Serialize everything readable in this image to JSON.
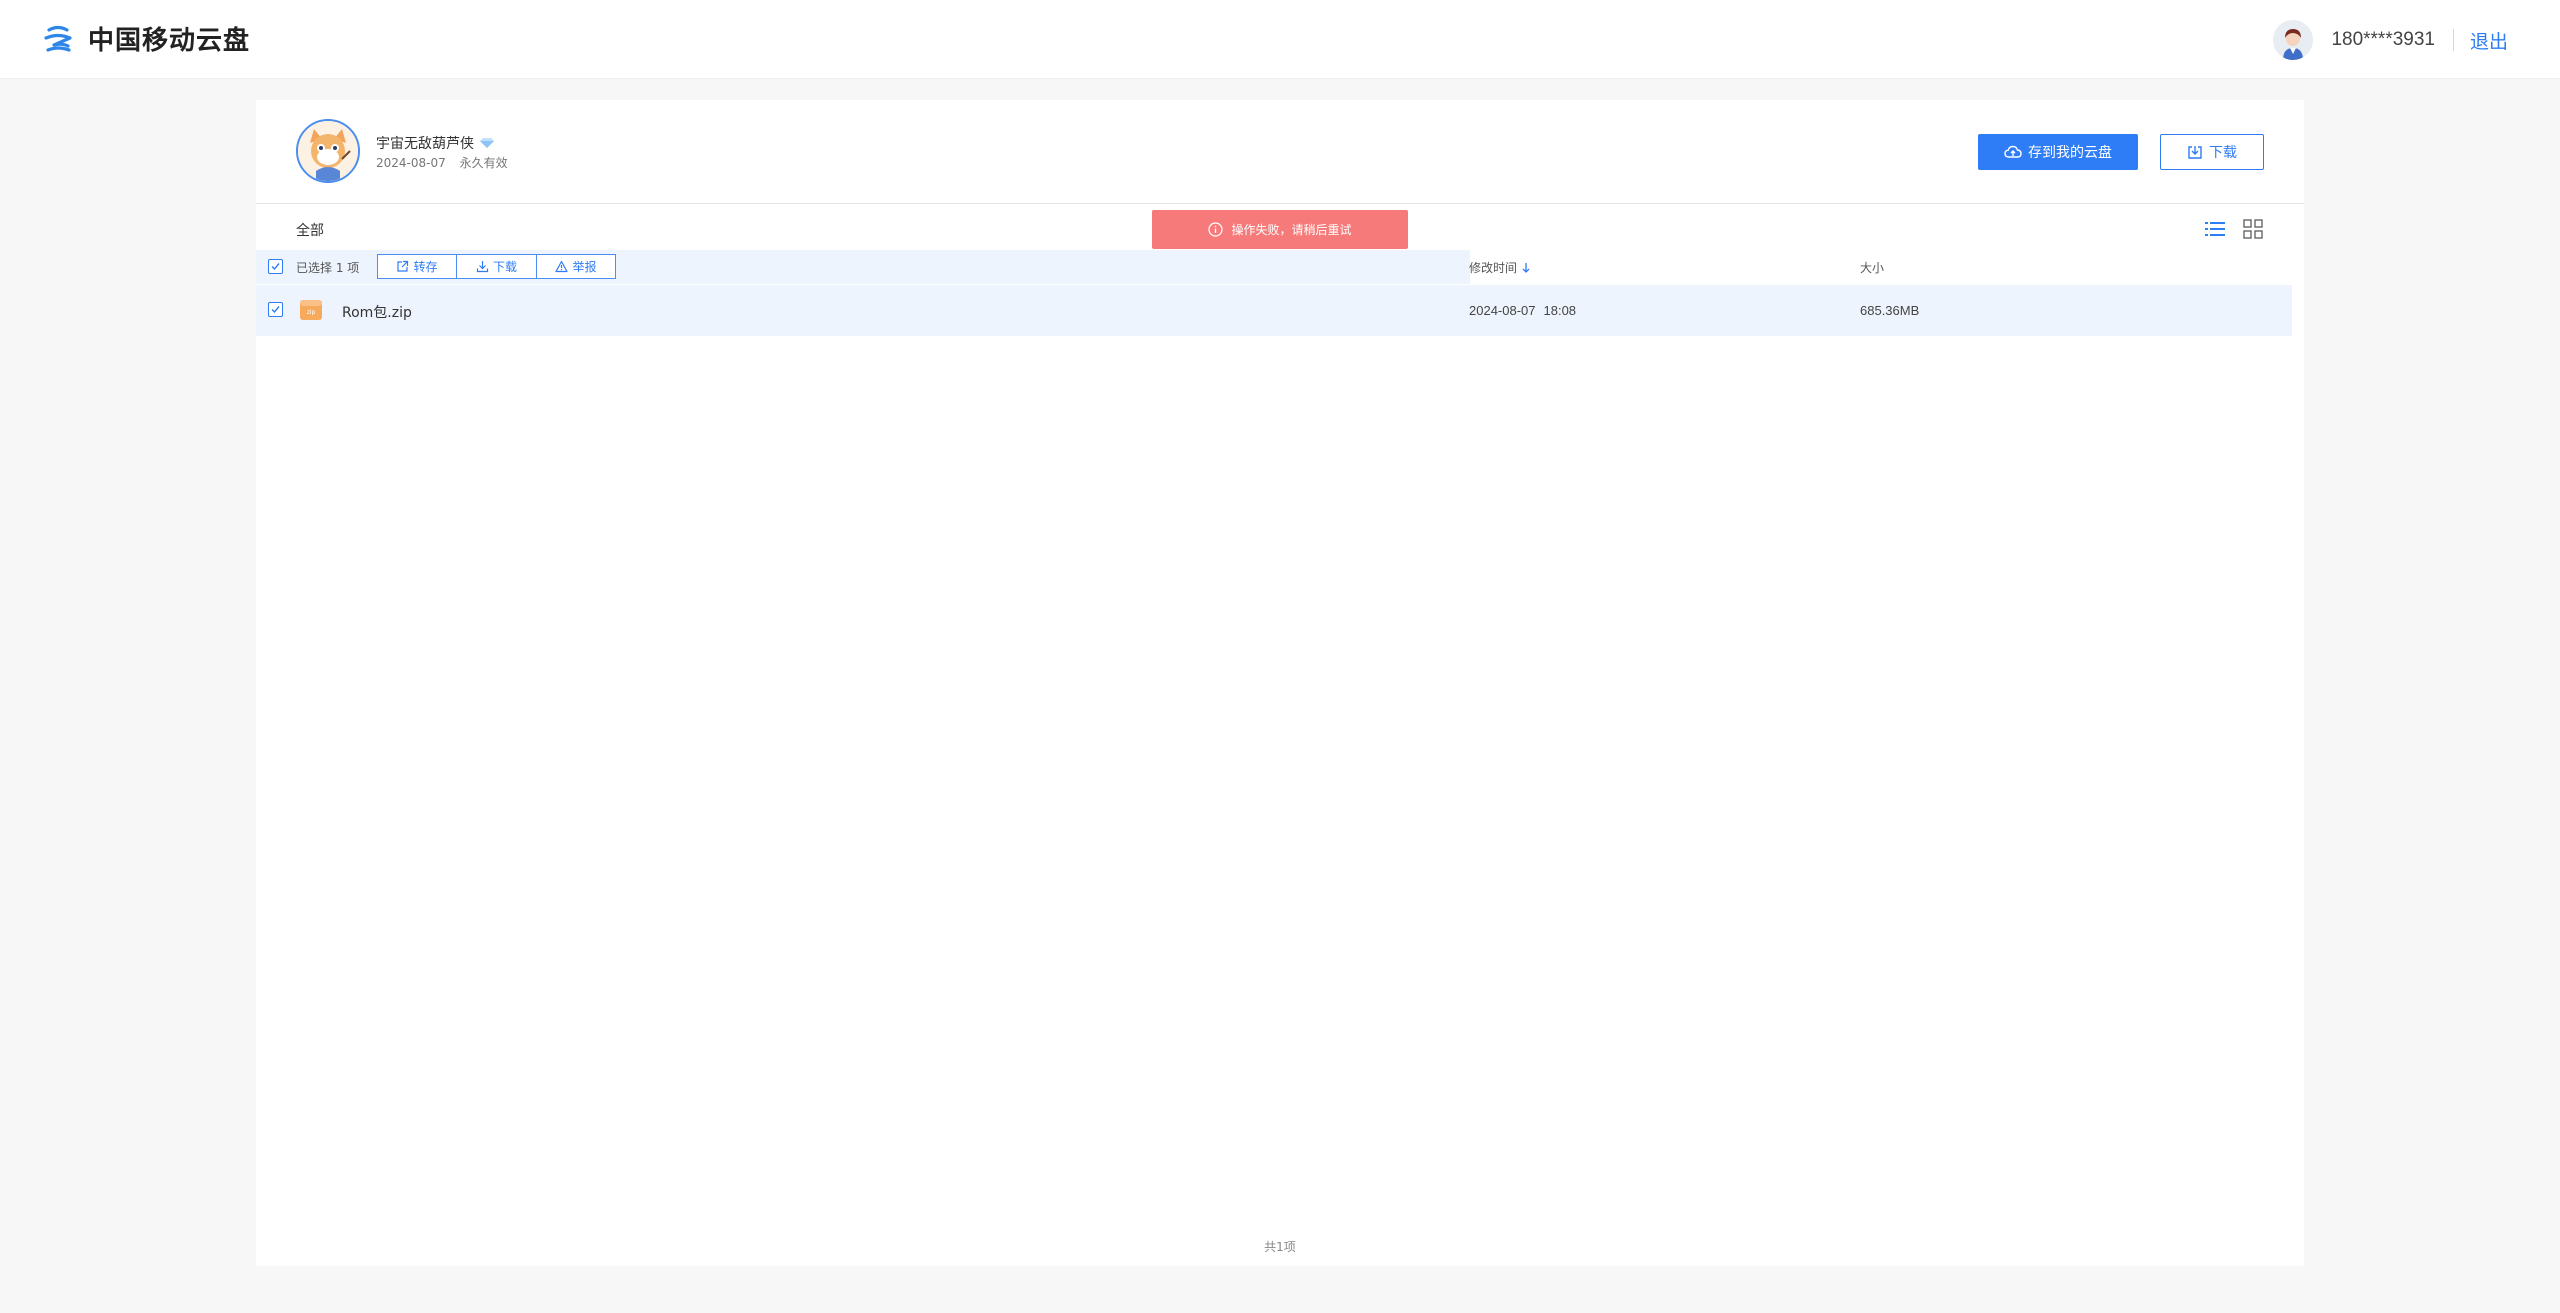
{
  "header": {
    "app_title": "中国移动云盘",
    "user_phone": "180****3931",
    "logout_label": "退出"
  },
  "share": {
    "sharer_name": "宇宙无敌葫芦侠",
    "share_date": "2024-08-07",
    "validity": "永久有效",
    "save_button_label": "存到我的云盘",
    "download_button_label": "下载"
  },
  "breadcrumb": {
    "root_label": "全部"
  },
  "toolbar": {
    "selected_count_label": "已选择 1 项",
    "actions": [
      {
        "label": "转存",
        "icon": "share-out-icon"
      },
      {
        "label": "下载",
        "icon": "download-icon"
      },
      {
        "label": "举报",
        "icon": "warning-icon"
      }
    ],
    "col_time_label": "修改时间",
    "col_size_label": "大小"
  },
  "files": [
    {
      "name": "Rom包.zip",
      "icon": "zip-file-icon",
      "date": "2024-08-07",
      "time": "18:08",
      "size": "685.36MB",
      "selected": true
    }
  ],
  "footer": {
    "total_label": "共1项"
  },
  "toast": {
    "message": "操作失败，请稍后重试"
  },
  "colors": {
    "accent": "#2e7cf6",
    "selected_row_bg": "#eef4fd",
    "toast_bg": "#f77a7a",
    "page_bg": "#f7f7f8"
  }
}
